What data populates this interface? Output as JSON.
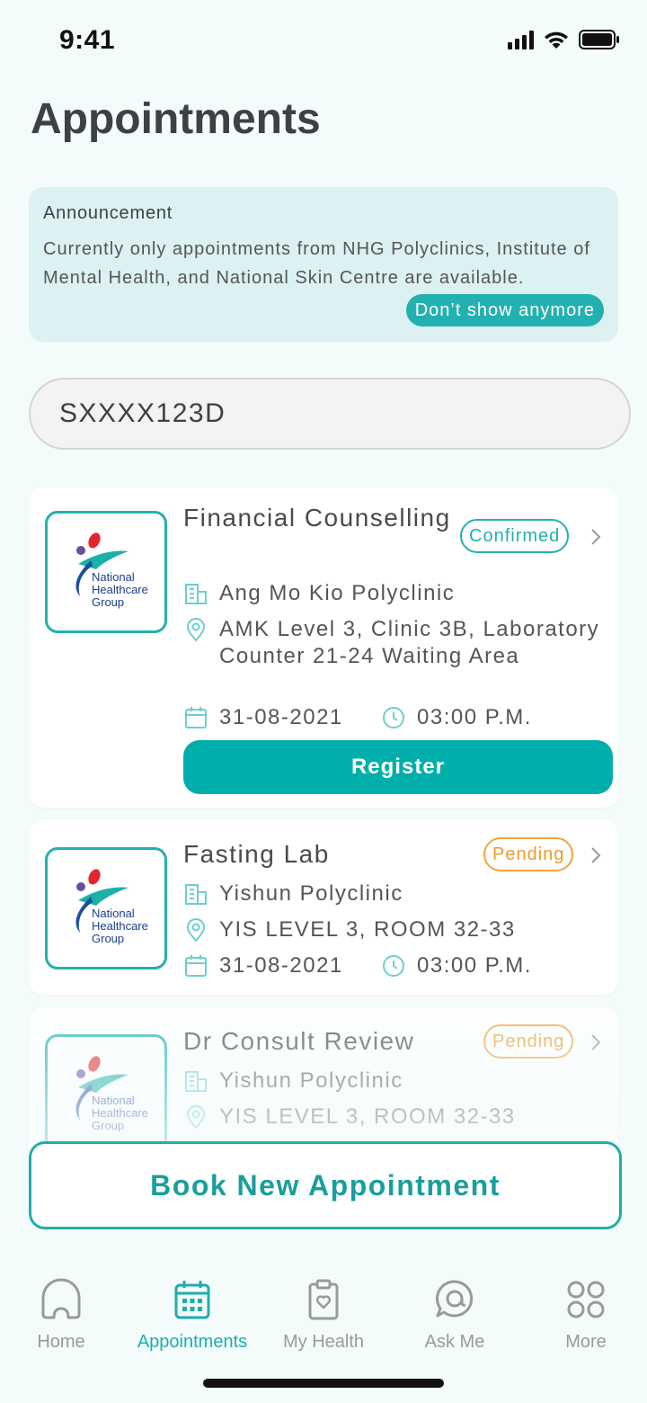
{
  "status_bar": {
    "time": "9:41"
  },
  "page_title": "Appointments",
  "announcement": {
    "title": "Announcement",
    "body": "Currently only appointments from NHG Polyclinics, Institute of Mental Health, and National Skin Centre are available.",
    "dismiss_label": "Don’t show anymore"
  },
  "nric_field": {
    "value": "SXXXX123D"
  },
  "logo_text": {
    "line1": "National",
    "line2": "Healthcare",
    "line3": "Group"
  },
  "appointments": [
    {
      "title": "Financial Counselling",
      "status": "Confirmed",
      "clinic": "Ang Mo Kio Polyclinic",
      "location": "AMK Level 3, Clinic 3B, Laboratory Counter 21-24 Waiting Area",
      "date": "31-08-2021",
      "time": "03:00 P.M.",
      "action_label": "Register"
    },
    {
      "title": "Fasting Lab",
      "status": "Pending",
      "clinic": "Yishun Polyclinic",
      "location": "YIS LEVEL 3, ROOM 32-33",
      "date": "31-08-2021",
      "time": "03:00 P.M."
    },
    {
      "title": "Dr Consult Review",
      "status": "Pending",
      "clinic": "Yishun Polyclinic",
      "location": "YIS LEVEL 3, ROOM 32-33"
    }
  ],
  "book_button_label": "Book New Appointment",
  "nav": [
    {
      "label": "Home",
      "icon": "home-icon"
    },
    {
      "label": "Appointments",
      "icon": "calendar-icon",
      "active": true
    },
    {
      "label": "My Health",
      "icon": "clipboard-heart-icon"
    },
    {
      "label": "Ask Me",
      "icon": "chat-bubble-icon"
    },
    {
      "label": "More",
      "icon": "grid-icon"
    }
  ],
  "colors": {
    "accent": "#22b1b0",
    "pending": "#f09a2c",
    "background": "#f4fbfb",
    "announcement_bg": "#dcf1f2"
  }
}
